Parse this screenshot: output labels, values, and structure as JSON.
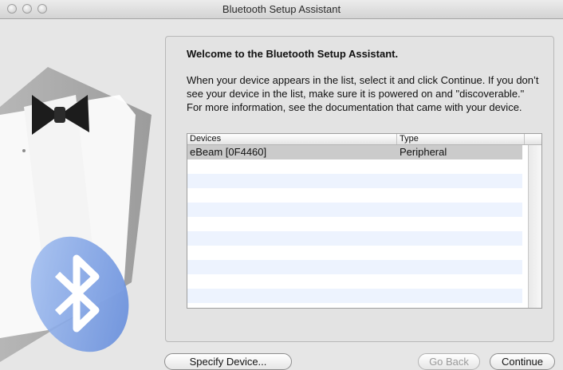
{
  "window": {
    "title": "Bluetooth Setup Assistant"
  },
  "intro": {
    "heading": "Welcome to the Bluetooth Setup Assistant.",
    "body": "When your device appears in the list, select it and click Continue. If you don’t see your device in the list, make sure it is powered on and \"discoverable.\" For more information, see the documentation that came with your device."
  },
  "devices_table": {
    "columns": [
      "Devices",
      "Type"
    ],
    "rows": [
      {
        "device": "eBeam [0F4460]",
        "type": "Peripheral",
        "selected": true
      }
    ],
    "empty_rows": 10
  },
  "buttons": {
    "specify": "Specify Device...",
    "back": "Go Back",
    "continue": "Continue"
  },
  "icons": [
    "bluetooth-icon",
    "tuxedo-illustration"
  ],
  "colors": {
    "selected_row": "#cbcbcb",
    "alt_row": "#edf3fe"
  }
}
